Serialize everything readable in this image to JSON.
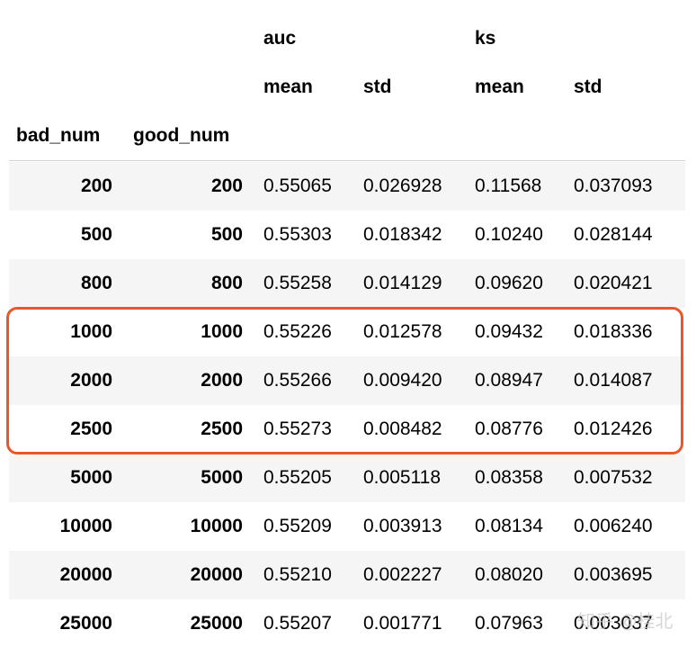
{
  "header": {
    "group_auc": "auc",
    "group_ks": "ks",
    "auc_mean": "mean",
    "auc_std": "std",
    "ks_mean": "mean",
    "ks_std": "std",
    "index_bad": "bad_num",
    "index_good": "good_num"
  },
  "rows": [
    {
      "bad_num": "200",
      "good_num": "200",
      "auc_mean": "0.55065",
      "auc_std": "0.026928",
      "ks_mean": "0.11568",
      "ks_std": "0.037093"
    },
    {
      "bad_num": "500",
      "good_num": "500",
      "auc_mean": "0.55303",
      "auc_std": "0.018342",
      "ks_mean": "0.10240",
      "ks_std": "0.028144"
    },
    {
      "bad_num": "800",
      "good_num": "800",
      "auc_mean": "0.55258",
      "auc_std": "0.014129",
      "ks_mean": "0.09620",
      "ks_std": "0.020421"
    },
    {
      "bad_num": "1000",
      "good_num": "1000",
      "auc_mean": "0.55226",
      "auc_std": "0.012578",
      "ks_mean": "0.09432",
      "ks_std": "0.018336"
    },
    {
      "bad_num": "2000",
      "good_num": "2000",
      "auc_mean": "0.55266",
      "auc_std": "0.009420",
      "ks_mean": "0.08947",
      "ks_std": "0.014087"
    },
    {
      "bad_num": "2500",
      "good_num": "2500",
      "auc_mean": "0.55273",
      "auc_std": "0.008482",
      "ks_mean": "0.08776",
      "ks_std": "0.012426"
    },
    {
      "bad_num": "5000",
      "good_num": "5000",
      "auc_mean": "0.55205",
      "auc_std": "0.005118",
      "ks_mean": "0.08358",
      "ks_std": "0.007532"
    },
    {
      "bad_num": "10000",
      "good_num": "10000",
      "auc_mean": "0.55209",
      "auc_std": "0.003913",
      "ks_mean": "0.08134",
      "ks_std": "0.006240"
    },
    {
      "bad_num": "20000",
      "good_num": "20000",
      "auc_mean": "0.55210",
      "auc_std": "0.002227",
      "ks_mean": "0.08020",
      "ks_std": "0.003695"
    },
    {
      "bad_num": "25000",
      "good_num": "25000",
      "auc_mean": "0.55207",
      "auc_std": "0.001771",
      "ks_mean": "0.07963",
      "ks_std": "0.003037"
    }
  ],
  "highlight": {
    "color": "#e8572a"
  },
  "watermark": "知乎 @桂北"
}
